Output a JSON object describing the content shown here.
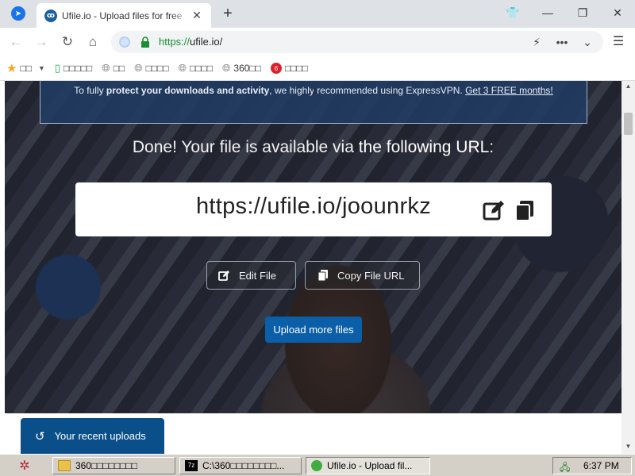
{
  "browser": {
    "tab": {
      "title": "Ufile.io - Upload files for free",
      "favicon_text": "ꝏ"
    },
    "new_tab_symbol": "+",
    "window_controls": [
      "👕",
      "—",
      "❐",
      "✕"
    ],
    "address": {
      "scheme": "https://",
      "host": "ufile.io/"
    },
    "bookmarks": [
      {
        "label": "□□",
        "icon": "star-icon"
      },
      {
        "label": "□□□□□",
        "icon": "phone-icon"
      },
      {
        "label": "□□",
        "icon": "globe-icon"
      },
      {
        "label": "□□□□",
        "icon": "globe-icon"
      },
      {
        "label": "□□□□",
        "icon": "globe-icon"
      },
      {
        "label": "360□□",
        "icon": "globe-icon"
      },
      {
        "label": "□□□□",
        "icon": "red-360-icon"
      }
    ]
  },
  "page": {
    "vpn_banner": {
      "text_1": "To fully ",
      "text_bold": "protect your downloads and activity",
      "text_2": ", we highly recommended using ExpressVPN. ",
      "link": "Get 3 FREE months!"
    },
    "heading_1": "Done! Your file is available via ",
    "heading_bold": "the following URL",
    "heading_2": ":",
    "file_url": "https://ufile.io/joounrkz",
    "edit_file_label": "Edit File",
    "copy_url_label": "Copy File URL",
    "upload_more_label": "Upload more files",
    "recent_uploads_label": "Your recent uploads"
  },
  "taskbar": {
    "tasks": [
      {
        "label": "360□□□□□□□□",
        "icon": "folder-icon"
      },
      {
        "label": "C:\\360□□□□□□□□...",
        "icon": "7zip-icon"
      },
      {
        "label": "Ufile.io - Upload fil...",
        "icon": "browser-icon"
      }
    ],
    "clock": "6:37 PM"
  },
  "colors": {
    "primary": "#0b5ea8",
    "recent_tab": "#0b4f8a",
    "secure_green": "#1a8f32"
  }
}
